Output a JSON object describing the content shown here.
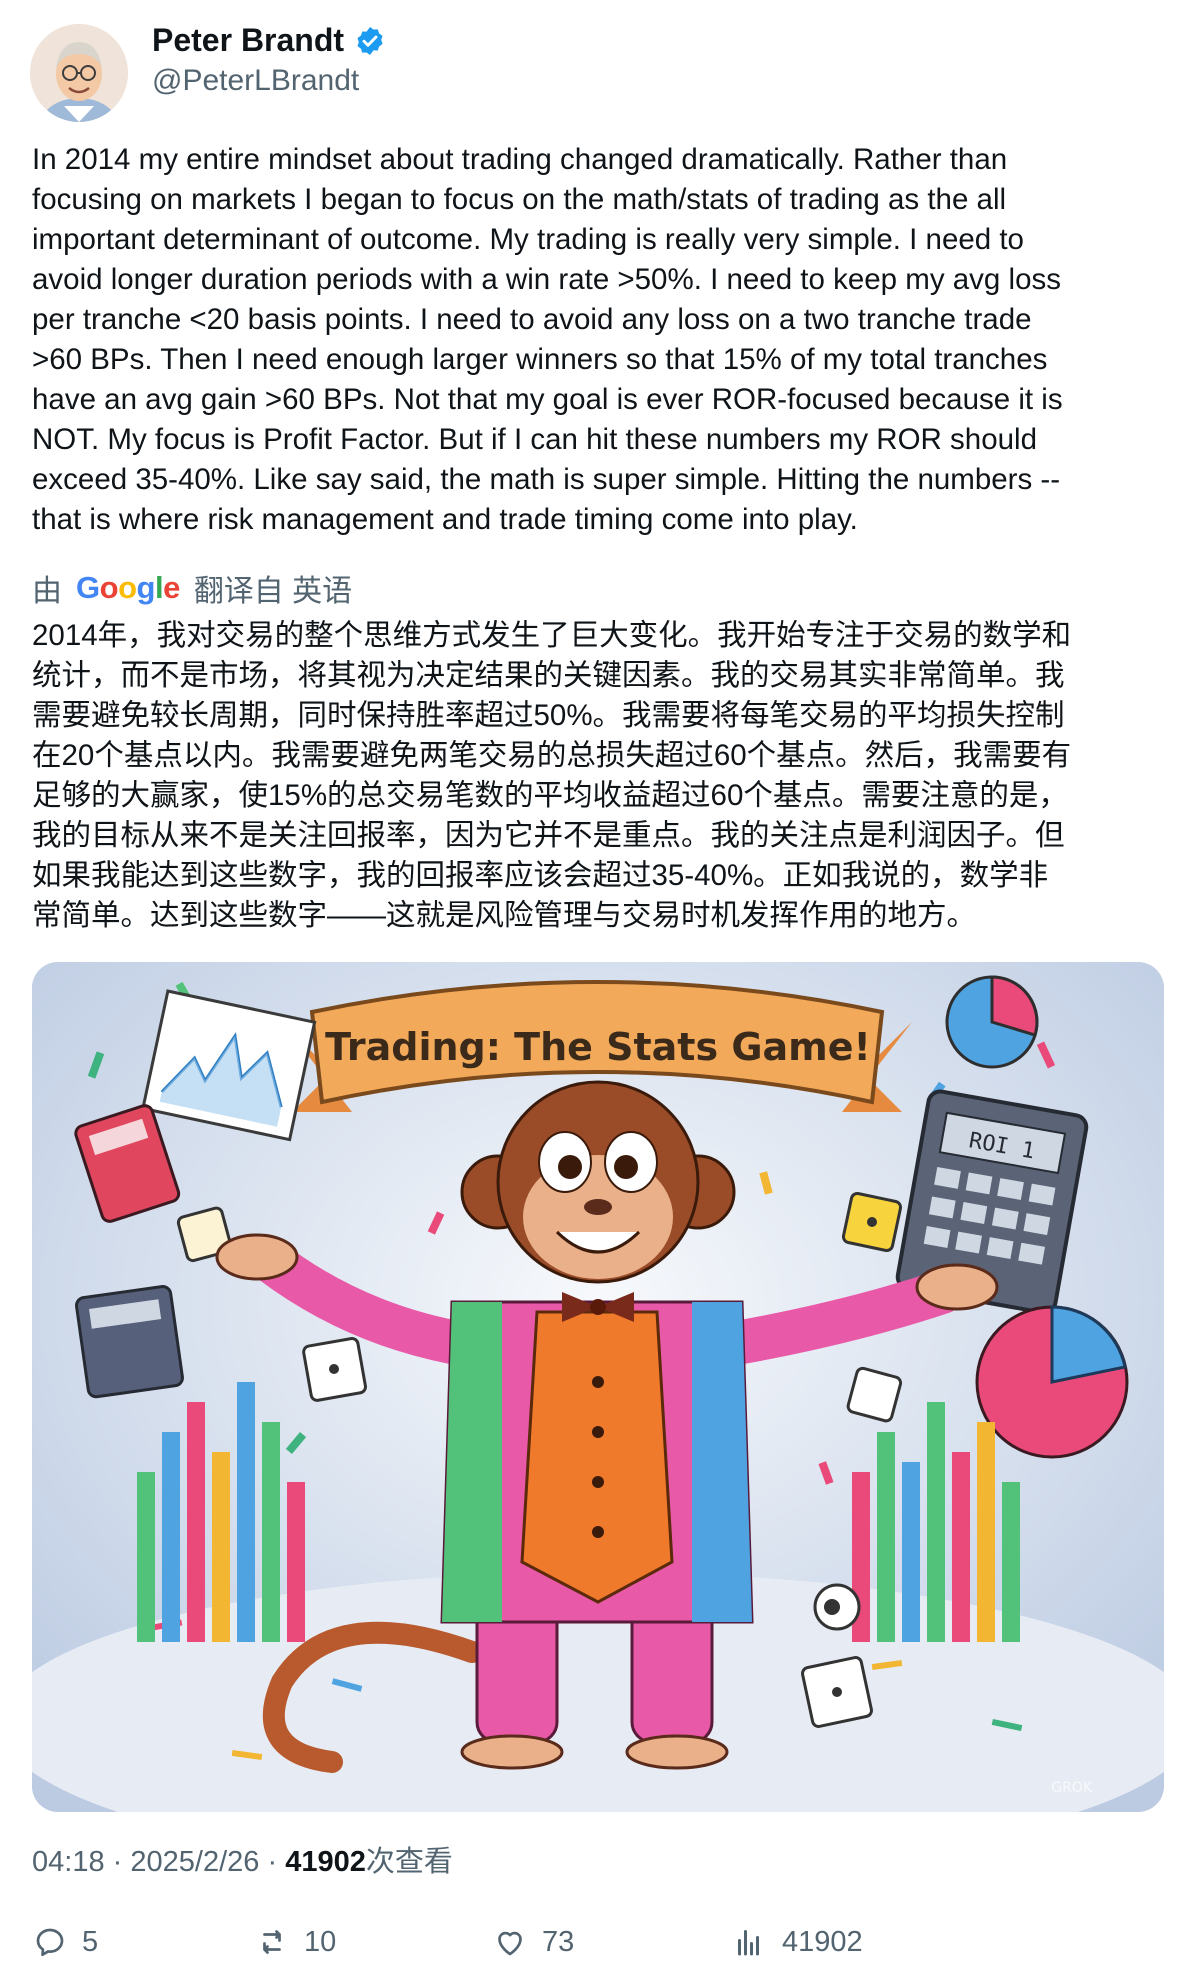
{
  "author": {
    "name": "Peter Brandt",
    "handle": "@PeterLBrandt",
    "verified_icon": "verified-badge-icon"
  },
  "tweet": {
    "text": "In 2014 my entire mindset about trading changed dramatically. Rather than\nfocusing on markets I began to focus on the math/stats of trading as the all\nimportant determinant of outcome. My trading is really very simple. I need to\navoid longer duration periods with a win rate >50%. I need to keep my avg loss\nper tranche <20 basis points. I need to avoid any loss on a two tranche trade\n>60 BPs. Then I need enough larger winners so that 15% of my total tranches\nhave an avg gain >60 BPs. Not that my goal is ever ROR-focused because it is\nNOT. My focus is Profit Factor. But if I can hit these numbers my ROR should\nexceed 35-40%. Like say said, the math is super simple. Hitting the numbers --\nthat is where risk management and trade timing come into play."
  },
  "translation": {
    "prefix": "由",
    "provider": "Google",
    "suffix": "翻译自 英语",
    "text": "2014年，我对交易的整个思维方式发生了巨大变化。我开始专注于交易的数学和\n统计，而不是市场，将其视为决定结果的关键因素。我的交易其实非常简单。我\n需要避免较长周期，同时保持胜率超过50%。我需要将每笔交易的平均损失控制\n在20个基点以内。我需要避免两笔交易的总损失超过60个基点。然后，我需要有\n足够的大赢家，使15%的总交易笔数的平均收益超过60个基点。需要注意的是，\n我的目标从来不是关注回报率，因为它并不是重点。我的关注点是利润因子。但\n如果我能达到这些数字，我的回报率应该会超过35-40%。正如我说的，数学非\n常简单。达到这些数字——这就是风险管理与交易时机发挥作用的地方。"
  },
  "media": {
    "banner_text": "Trading: The Stats Game!",
    "calculator_display": "ROI 1",
    "watermark": "GROK",
    "colors": {
      "background": "#dfe7f2",
      "banner": "#f2a95a",
      "fur": "#9a4b27",
      "jacket": "#e85aa8",
      "vest": "#f07a2c"
    }
  },
  "meta": {
    "time": "04:18",
    "separator": "·",
    "date": "2025/2/26",
    "views": "41902",
    "views_label": "次查看"
  },
  "actions": {
    "replies": "5",
    "reposts": "10",
    "likes": "73",
    "views": "41902"
  },
  "colors": {
    "text": "#0f1419",
    "secondary": "#536471",
    "verified": "#1d9bf0"
  }
}
